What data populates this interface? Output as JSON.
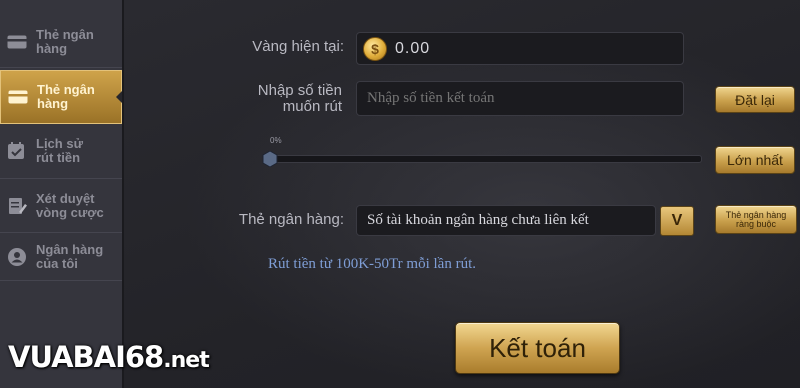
{
  "sidebar": {
    "items": [
      {
        "label": "Thẻ ngân hàng",
        "icon": "card-icon",
        "active": false
      },
      {
        "label": "Thẻ ngân hàng",
        "icon": "card-icon",
        "active": true
      },
      {
        "label": "Lịch sử rút tiền",
        "icon": "calendar-check-icon",
        "active": false
      },
      {
        "label": "Xét duyệt vòng cược",
        "icon": "edit-document-icon",
        "active": false
      },
      {
        "label": "Ngân hàng của tôi",
        "icon": "user-icon",
        "active": false
      }
    ]
  },
  "form": {
    "balance_label": "Vàng hiện tại:",
    "balance_value": "0.00",
    "amount_label": "Nhập số tiền muốn rút",
    "amount_placeholder": "Nhập số tiền kết toán",
    "reset_button": "Đặt lại",
    "slider_percent": "0%",
    "max_button": "Lớn nhất",
    "bank_label": "Thẻ ngân hàng:",
    "bank_value": "Số tài khoản ngân hàng chưa liên kết",
    "dropdown_glyph": "V",
    "link_bank_button": "Thẻ ngân hàng ràng buộc",
    "note": "Rút tiền từ 100K-50Tr mỗi lần rút.",
    "submit_button": "Kết toán"
  },
  "watermark": {
    "text": "VUABAI68",
    "suffix": ".net"
  },
  "colors": {
    "accent": "#cfa451",
    "note": "#7f9ed6",
    "sidebar_bg": "#35353d"
  }
}
